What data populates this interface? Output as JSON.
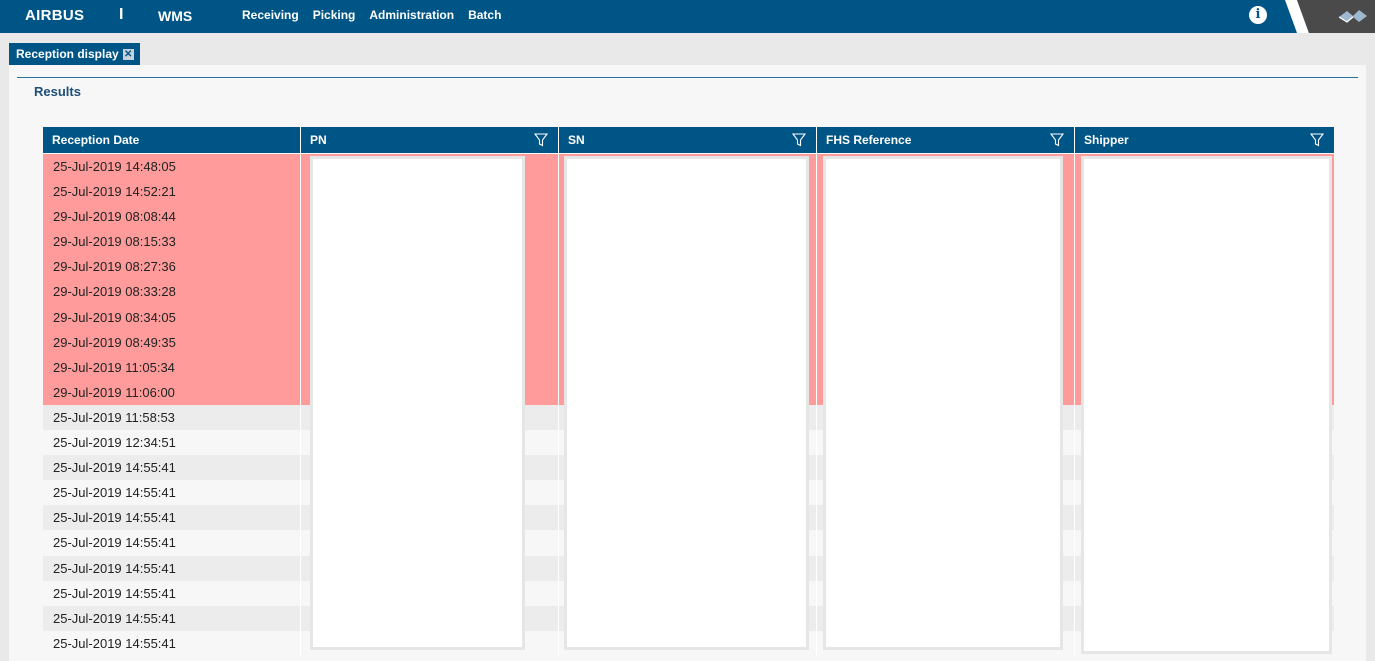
{
  "topbar": {
    "brand": "AIRBUS",
    "separator": "I",
    "app": "WMS",
    "nav": [
      "Receiving",
      "Picking",
      "Administration",
      "Batch"
    ],
    "info_icon": "info-icon",
    "corner_logo": "company-logo",
    "bar_color": "#005587"
  },
  "tab": {
    "label": "Reception display",
    "close_icon": "close-icon"
  },
  "results": {
    "title": "Results"
  },
  "grid": {
    "columns": [
      {
        "label": "Reception Date",
        "filter": false
      },
      {
        "label": "PN",
        "filter": true
      },
      {
        "label": "SN",
        "filter": true
      },
      {
        "label": "FHS Reference",
        "filter": true
      },
      {
        "label": "Shipper",
        "filter": true
      }
    ],
    "rows": [
      {
        "date": "25-Jul-2019 14:48:05",
        "status": "error"
      },
      {
        "date": "25-Jul-2019 14:52:21",
        "status": "error"
      },
      {
        "date": "29-Jul-2019 08:08:44",
        "status": "error"
      },
      {
        "date": "29-Jul-2019 08:15:33",
        "status": "error"
      },
      {
        "date": "29-Jul-2019 08:27:36",
        "status": "error"
      },
      {
        "date": "29-Jul-2019 08:33:28",
        "status": "error"
      },
      {
        "date": "29-Jul-2019 08:34:05",
        "status": "error"
      },
      {
        "date": "29-Jul-2019 08:49:35",
        "status": "error"
      },
      {
        "date": "29-Jul-2019 11:05:34",
        "status": "error"
      },
      {
        "date": "29-Jul-2019 11:06:00",
        "status": "error"
      },
      {
        "date": "25-Jul-2019 11:58:53",
        "status": "normal"
      },
      {
        "date": "25-Jul-2019 12:34:51",
        "status": "normal"
      },
      {
        "date": "25-Jul-2019 14:55:41",
        "status": "normal"
      },
      {
        "date": "25-Jul-2019 14:55:41",
        "status": "normal"
      },
      {
        "date": "25-Jul-2019 14:55:41",
        "status": "normal"
      },
      {
        "date": "25-Jul-2019 14:55:41",
        "status": "normal"
      },
      {
        "date": "25-Jul-2019 14:55:41",
        "status": "normal"
      },
      {
        "date": "25-Jul-2019 14:55:41",
        "status": "normal"
      },
      {
        "date": "25-Jul-2019 14:55:41",
        "status": "normal"
      },
      {
        "date": "25-Jul-2019 14:55:41",
        "status": "normal"
      }
    ],
    "error_color": "#ff9b9b"
  }
}
